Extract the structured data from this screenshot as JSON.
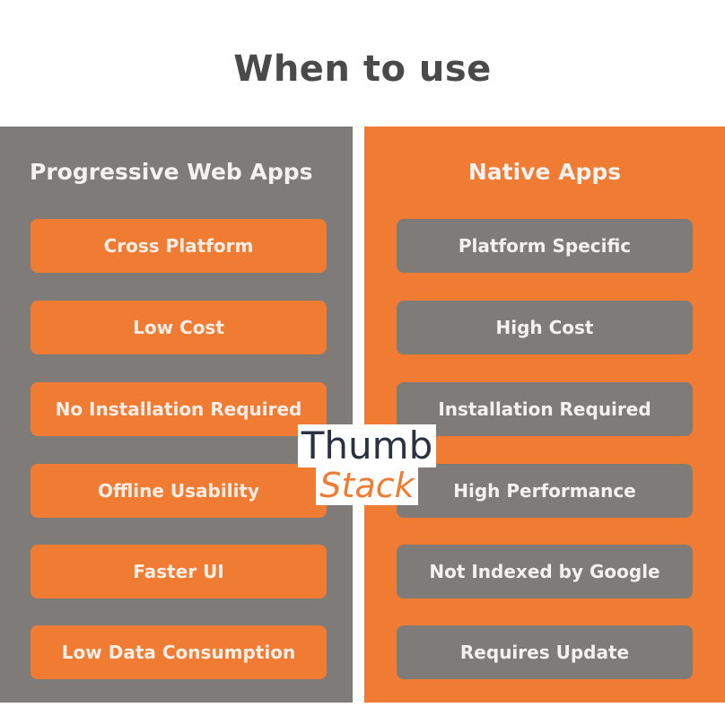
{
  "title": "When to use",
  "left_panel": {
    "heading": "Progressive Web Apps",
    "items": [
      "Cross Platform",
      "Low Cost",
      "No Installation Required",
      "Offline Usability",
      "Faster UI",
      "Low Data Consumption"
    ]
  },
  "right_panel": {
    "heading": "Native Apps",
    "items": [
      "Platform Specific",
      "High Cost",
      "Installation Required",
      "High Performance",
      "Not Indexed by Google",
      "Requires Update"
    ]
  },
  "watermark": {
    "line1": "Thumb",
    "line2": "Stack"
  },
  "colors": {
    "orange": "#f07c34",
    "gray": "#7e7b79",
    "title_text": "#4a4a4a",
    "watermark_dark": "#2a3142"
  }
}
